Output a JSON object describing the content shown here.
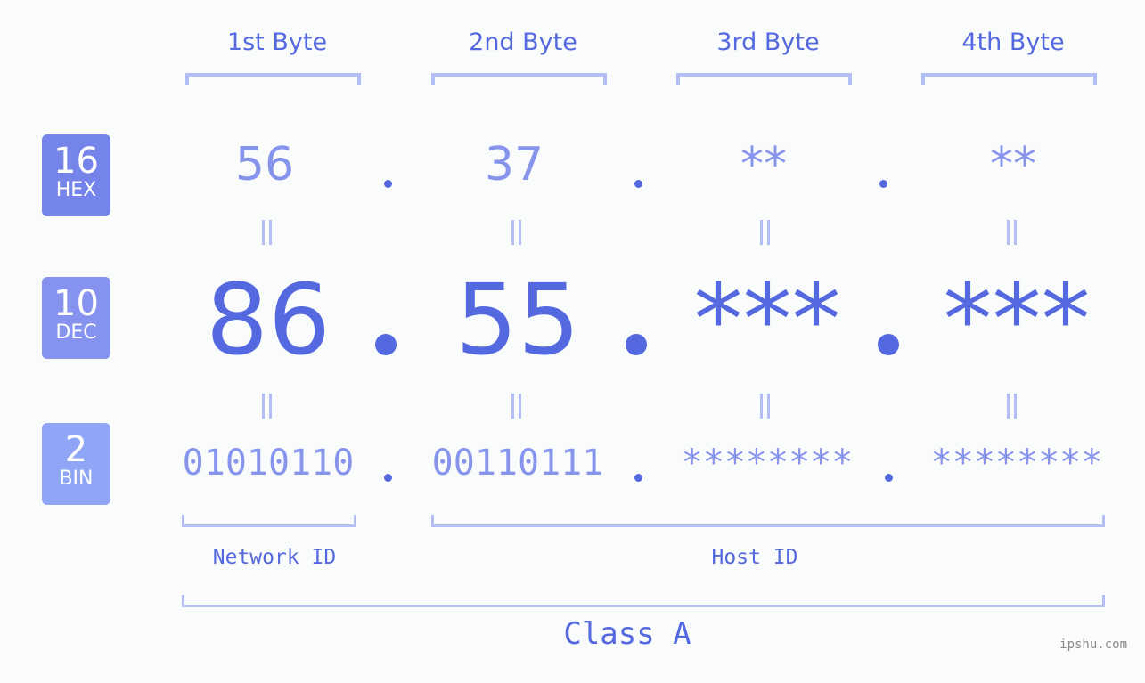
{
  "bytes": [
    {
      "header": "1st Byte",
      "hex": "56",
      "dec": "86",
      "bin": "01010110"
    },
    {
      "header": "2nd Byte",
      "hex": "37",
      "dec": "55",
      "bin": "00110111"
    },
    {
      "header": "3rd Byte",
      "hex": "**",
      "dec": "***",
      "bin": "********"
    },
    {
      "header": "4th Byte",
      "hex": "**",
      "dec": "***",
      "bin": "********"
    }
  ],
  "badges": {
    "hex": {
      "num": "16",
      "label": "HEX",
      "color": "#7584ea"
    },
    "dec": {
      "num": "10",
      "label": "DEC",
      "color": "#8592ee"
    },
    "bin": {
      "num": "2",
      "label": "BIN",
      "color": "#8fa5f5"
    }
  },
  "labels": {
    "network_id": "Network ID",
    "host_id": "Host ID",
    "class": "Class A"
  },
  "watermark": "ipshu.com"
}
